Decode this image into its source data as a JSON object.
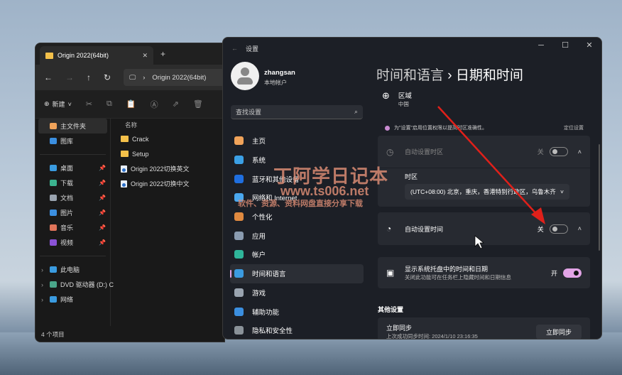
{
  "explorer": {
    "tab_title": "Origin 2022(64bit)",
    "address": "Origin 2022(64bit)",
    "new_label": "新建",
    "sidebar": [
      {
        "label": "主文件夹",
        "icon": "home-icon",
        "selected": true
      },
      {
        "label": "图库",
        "icon": "gallery-icon"
      }
    ],
    "quick_access": [
      {
        "label": "桌面",
        "icon": "desktop-icon",
        "color": "#3a9be0"
      },
      {
        "label": "下载",
        "icon": "download-icon",
        "color": "#3bb38f"
      },
      {
        "label": "文档",
        "icon": "document-icon",
        "color": "#9aa4b0"
      },
      {
        "label": "图片",
        "icon": "pictures-icon",
        "color": "#3b8fe0"
      },
      {
        "label": "音乐",
        "icon": "music-icon",
        "color": "#e0745a"
      },
      {
        "label": "视频",
        "icon": "video-icon",
        "color": "#8a52d6"
      }
    ],
    "locations": [
      {
        "label": "此电脑",
        "icon": "pc-icon",
        "color": "#3a9be0"
      },
      {
        "label": "DVD 驱动器 (D:) C",
        "icon": "dvd-icon",
        "color": "#4aa68a"
      },
      {
        "label": "网络",
        "icon": "network-icon",
        "color": "#3a9be0"
      }
    ],
    "column_name": "名称",
    "files": [
      {
        "name": "Crack",
        "type": "folder"
      },
      {
        "name": "Setup",
        "type": "folder"
      },
      {
        "name": "Origin 2022切换英文",
        "type": "file"
      },
      {
        "name": "Origin 2022切换中文",
        "type": "file"
      }
    ],
    "status": "4 个项目"
  },
  "settings": {
    "title": "设置",
    "user": {
      "name": "zhangsan",
      "type": "本地帐户"
    },
    "search_placeholder": "查找设置",
    "nav": [
      {
        "label": "主页",
        "icon": "home-icon",
        "color": "#f0a35a"
      },
      {
        "label": "系统",
        "icon": "system-icon",
        "color": "#3ba0e6"
      },
      {
        "label": "蓝牙和其他设备",
        "icon": "bluetooth-icon",
        "color": "#1f6fe0"
      },
      {
        "label": "网络和 Internet",
        "icon": "wifi-icon",
        "color": "#4aa8f0"
      },
      {
        "label": "个性化",
        "icon": "brush-icon",
        "color": "#e08a40"
      },
      {
        "label": "应用",
        "icon": "apps-icon",
        "color": "#8a9bb0"
      },
      {
        "label": "帐户",
        "icon": "account-icon",
        "color": "#2fb59a"
      },
      {
        "label": "时间和语言",
        "icon": "time-language-icon",
        "color": "#3b9be0",
        "selected": true
      },
      {
        "label": "游戏",
        "icon": "gaming-icon",
        "color": "#9aa4b0"
      },
      {
        "label": "辅助功能",
        "icon": "accessibility-icon",
        "color": "#3b8fe0"
      },
      {
        "label": "隐私和安全性",
        "icon": "shield-icon",
        "color": "#8a9299"
      }
    ],
    "breadcrumb": {
      "parent": "时间和语言",
      "current": "日期和时间"
    },
    "region": {
      "label": "区域",
      "value": "中国"
    },
    "notice": {
      "text": "为\"设置\"启用位置权限以提高时区准确性。",
      "link": "定位设置"
    },
    "auto_timezone": {
      "label": "自动设置时区",
      "state": "关",
      "on": false
    },
    "timezone": {
      "label": "时区",
      "value": "(UTC+08:00) 北京，重庆，香港特别行政区，乌鲁木齐"
    },
    "auto_time": {
      "label": "自动设置时间",
      "state": "关",
      "on": false
    },
    "tray": {
      "label": "显示系统托盘中的时间和日期",
      "desc": "关闭此功能可在任务栏上隐藏时间和日期信息",
      "state": "开",
      "on": true
    },
    "other_heading": "其他设置",
    "sync": {
      "label": "立即同步",
      "desc": "上次成功同步时间: 2024/1/10 23:16:35",
      "button": "立即同步"
    }
  },
  "watermark": {
    "title": "丁阿学日记本",
    "url": "www.ts006.net",
    "tagline": "软件、资源、资料网盘直接分享下载"
  },
  "colors": {
    "accent": "#e2a4e6",
    "arrow": "#e0201a"
  }
}
